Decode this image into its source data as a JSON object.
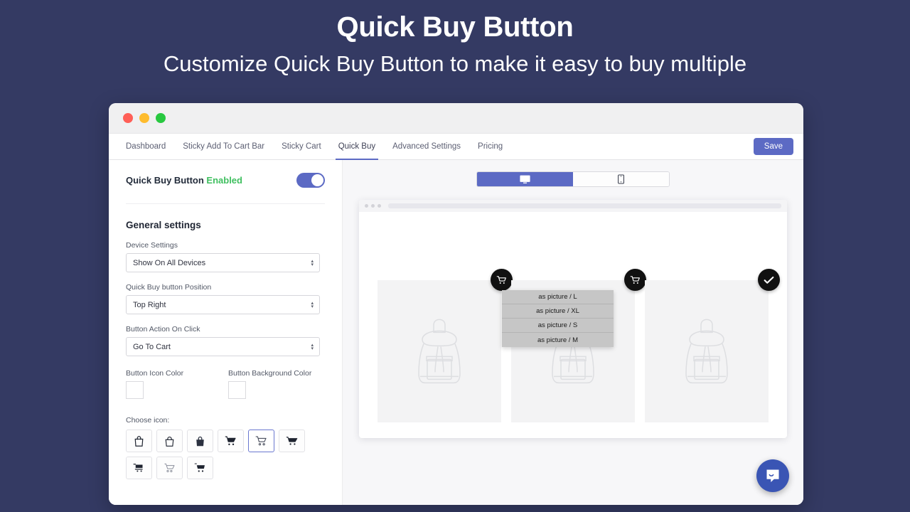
{
  "hero": {
    "title": "Quick Buy Button",
    "subtitle": "Customize Quick Buy Button to make it easy to buy multiple"
  },
  "window": {
    "traffic_lights": [
      "close-red",
      "minimize-yellow",
      "maximize-green"
    ]
  },
  "nav": {
    "tabs": [
      {
        "label": "Dashboard",
        "active": false
      },
      {
        "label": "Sticky Add To Cart Bar",
        "active": false
      },
      {
        "label": "Sticky Cart",
        "active": false
      },
      {
        "label": "Quick Buy",
        "active": true
      },
      {
        "label": "Advanced Settings",
        "active": false
      },
      {
        "label": "Pricing",
        "active": false
      }
    ],
    "save_label": "Save"
  },
  "enable_card": {
    "title": "Quick Buy Button",
    "status": "Enabled",
    "toggle_on": true
  },
  "general_settings": {
    "heading": "General settings",
    "fields": [
      {
        "label": "Device Settings",
        "value": "Show On All Devices"
      },
      {
        "label": "Quick Buy button Position",
        "value": "Top Right"
      },
      {
        "label": "Button Action On Click",
        "value": "Go To Cart"
      }
    ],
    "icon_color": {
      "label": "Button Icon Color",
      "value": "#F2F9F1"
    },
    "background_color": {
      "label": "Button Background Color",
      "value": "#000000"
    },
    "choose_icon_label": "Choose icon:",
    "icons": [
      {
        "name": "shopping-bag-icon",
        "selected": false
      },
      {
        "name": "tote-bag-outline-icon",
        "selected": false
      },
      {
        "name": "handbag-filled-icon",
        "selected": false
      },
      {
        "name": "shopping-cart-filled-icon",
        "selected": false
      },
      {
        "name": "shopping-cart-outline-icon",
        "selected": true
      },
      {
        "name": "shopping-cart-solid-icon",
        "selected": false
      },
      {
        "name": "cart-flat-icon",
        "selected": false
      },
      {
        "name": "cart-thin-outline-icon",
        "selected": false
      },
      {
        "name": "cart-basket-icon",
        "selected": false
      }
    ]
  },
  "preview": {
    "device_tabs": [
      {
        "name": "desktop-view",
        "icon": "monitor-icon",
        "active": true
      },
      {
        "name": "mobile-view",
        "icon": "mobile-icon",
        "active": false
      }
    ],
    "cards": [
      {
        "badge": "cart-icon",
        "has_variant_menu": false
      },
      {
        "badge": "cart-icon",
        "has_variant_menu": true
      },
      {
        "badge": "check-icon",
        "has_variant_menu": false
      }
    ],
    "variant_options": [
      "as picture / L",
      "as picture / XL",
      "as picture / S",
      "as picture / M"
    ]
  },
  "chat": {
    "name": "intercom-chat-button"
  },
  "colors": {
    "page_background": "#343A63",
    "accent": "#5C6AC4",
    "enabled_green": "#3FBF5F"
  }
}
